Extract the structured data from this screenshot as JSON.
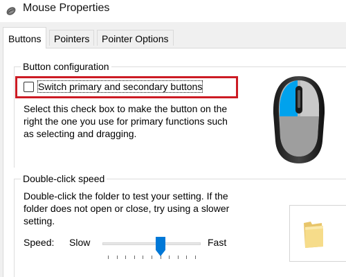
{
  "window": {
    "title": "Mouse Properties",
    "icon": "mouse-icon"
  },
  "tabs": [
    {
      "label": "Buttons",
      "active": true
    },
    {
      "label": "Pointers",
      "active": false
    },
    {
      "label": "Pointer Options",
      "active": false
    }
  ],
  "button_configuration": {
    "heading": "Button configuration",
    "checkbox_label": "Switch primary and secondary buttons",
    "checked": false,
    "description": [
      "Select this check box to make the button on the",
      "right the one you use for primary functions such",
      "as selecting and dragging."
    ],
    "preview_icon": "mouse-icon",
    "highlight_color": "#cc1b24"
  },
  "double_click": {
    "heading": "Double-click speed",
    "description": [
      "Double-click the folder to test your setting. If the",
      "folder does not open or close, try using a slower",
      "setting."
    ],
    "speed_label": "Speed:",
    "slow_label": "Slow",
    "fast_label": "Fast",
    "speed_fraction": 0.6,
    "test_icon": "folder-icon"
  },
  "colors": {
    "accent": "#0078d7",
    "mouse_highlight": "#00a2ed"
  }
}
